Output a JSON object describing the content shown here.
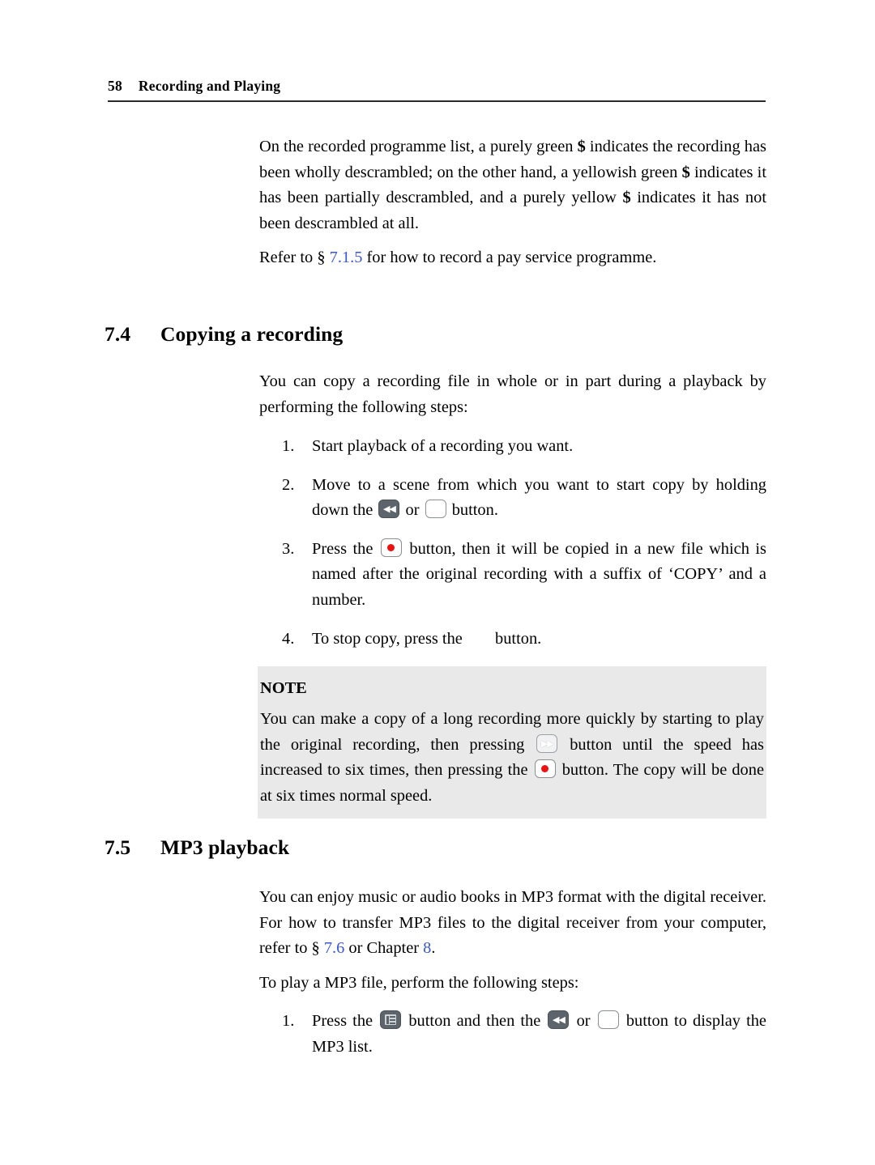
{
  "page": {
    "folio": "58",
    "running_title": "Recording and Playing"
  },
  "intro": {
    "paragraph_1_part_1": "On the recorded programme list, a purely green ",
    "dollar_1": "$",
    "paragraph_1_part_2": " indicates the recording has been wholly descrambled; on the other hand, a yellowish green ",
    "dollar_2": "$",
    "paragraph_1_part_3": " indicates it has been partially descrambled, and a purely yellow ",
    "dollar_3": "$",
    "paragraph_1_part_4": " indicates it has not been descrambled at all.",
    "refer_prefix": "Refer to § ",
    "refer_link": "7.1.5",
    "refer_suffix": " for how to record a pay service programme."
  },
  "section_74": {
    "number": "7.4",
    "title": "Copying a recording",
    "intro": "You can copy a recording file in whole or in part during a playback by performing the following steps:",
    "steps": [
      {
        "marker": "1.",
        "text": "Start playback of a recording you want."
      },
      {
        "marker": "2.",
        "part_1": "Move to a scene from which you want to start copy by holding down the ",
        "key_1": "rewind-key",
        "part_2": " or ",
        "key_2": "blank-key",
        "part_3": " button."
      },
      {
        "marker": "3.",
        "part_1": "Press the ",
        "key_1": "record-key",
        "part_2": " button, then it will be copied in a new file which is named after the original recording with a suffix of ‘COPY’ and a number."
      },
      {
        "marker": "4.",
        "part_1": "To stop copy, press the ",
        "key_1": "missing-key",
        "part_2": " button."
      }
    ]
  },
  "note": {
    "title": "NOTE",
    "part_1": "You can make a copy of a long recording more quickly by starting to play the original recording, then pressing ",
    "key_1": "fast-forward-key",
    "part_2": " button until the speed has increased to six times, then pressing the ",
    "key_2": "record-key",
    "part_3": " button. The copy will be done at six times normal speed."
  },
  "section_75": {
    "number": "7.5",
    "title": "MP3 playback",
    "para_1_part_1": "You can enjoy music or audio books in MP3 format with the digital receiver.  For how to transfer MP3 files to the digital receiver from your computer, refer to § ",
    "para_1_link_1": "7.6",
    "para_1_part_2": " or Chapter ",
    "para_1_link_2": "8",
    "para_1_part_3": ".",
    "para_2": "To play a MP3 file, perform the following steps:",
    "steps": [
      {
        "marker": "1.",
        "part_1": "Press the ",
        "key_1": "list-key",
        "part_2": " button and then the ",
        "key_2": "rewind-key",
        "part_3": " or ",
        "key_3": "blank-key",
        "part_4": " button to display the MP3 list."
      }
    ]
  },
  "colors": {
    "link": "#3a57d8",
    "note_background": "#e9e9e9",
    "record_dot": "#ee1111",
    "key_body": "#5d646b"
  }
}
